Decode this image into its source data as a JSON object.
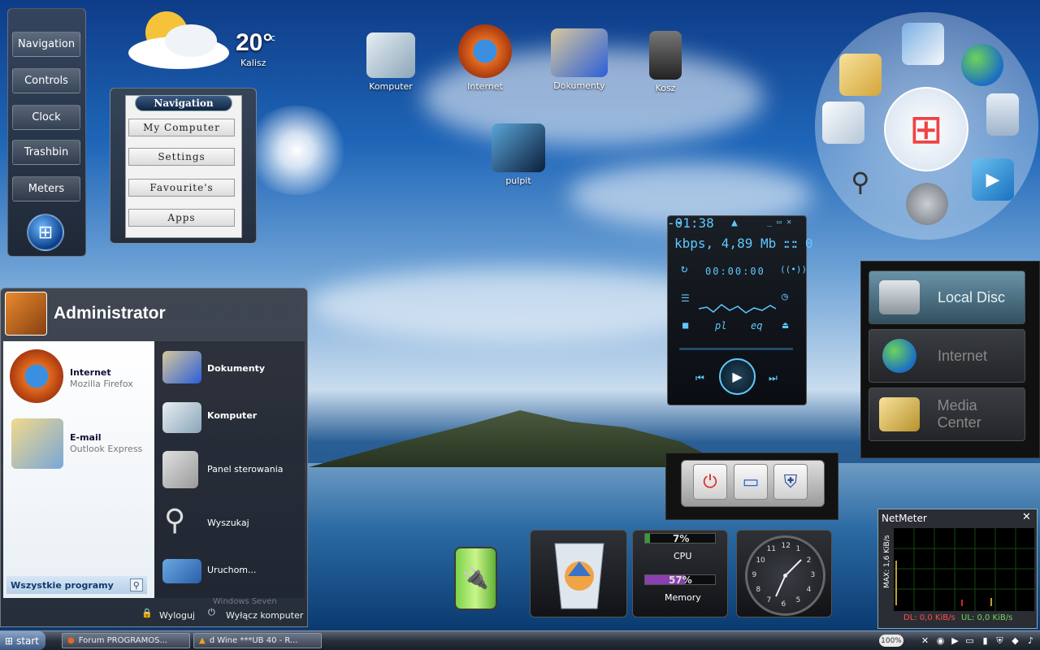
{
  "sidebar": {
    "items": [
      {
        "label": "Navigation"
      },
      {
        "label": "Controls"
      },
      {
        "label": "Clock"
      },
      {
        "label": "Trashbin"
      },
      {
        "label": "Meters"
      }
    ]
  },
  "weather": {
    "temp": "20°",
    "unit": "c",
    "city": "Kalisz"
  },
  "nav_panel": {
    "title": "Navigation",
    "buttons": [
      "My Computer",
      "Settings",
      "Favourite's",
      "Apps"
    ]
  },
  "desktop_icons": [
    {
      "label": "Komputer"
    },
    {
      "label": "Internet"
    },
    {
      "label": "Dokumenty"
    },
    {
      "label": "Kosz"
    },
    {
      "label": "pulpit"
    }
  ],
  "player": {
    "info": "kbps, 4,89 Mb ::",
    "info_right": ":: 0",
    "time": "-01:38",
    "elapsed": "00:00:00",
    "pl": "pl",
    "eq": "eq"
  },
  "quick_launch": [
    {
      "label": "Local Disc"
    },
    {
      "label": "Internet"
    },
    {
      "label": "Media Center"
    }
  ],
  "meters": {
    "cpu_value": "7%",
    "cpu_label": "CPU",
    "cpu_percent": 7,
    "memory_value": "57%",
    "memory_label": "Memory",
    "memory_percent": 57
  },
  "clock": {
    "numbers": [
      "12",
      "1",
      "2",
      "3",
      "4",
      "5",
      "6",
      "7",
      "8",
      "9",
      "10",
      "11"
    ]
  },
  "netmeter": {
    "title": "NetMeter",
    "close": "✕",
    "max": "MAX: 1,6 KiB/s",
    "dl": "DL: 0,0 KiB/s",
    "ul": "UL: 0,0 KiB/s"
  },
  "start_menu": {
    "user": "Administrator",
    "pinned": [
      {
        "title": "Internet",
        "subtitle": "Mozilla Firefox"
      },
      {
        "title": "E-mail",
        "subtitle": "Outlook Express"
      }
    ],
    "right_items": [
      {
        "label": "Dokumenty"
      },
      {
        "label": "Komputer"
      },
      {
        "label": "Panel sterowania"
      },
      {
        "label": "Wyszukaj"
      },
      {
        "label": "Uruchom..."
      }
    ],
    "all_programs": "Wszystkie programy",
    "logoff": "Wyloguj",
    "shutdown": "Wyłącz komputer",
    "watermark": "Windows Seven"
  },
  "taskbar": {
    "start": "start",
    "tasks": [
      {
        "label": "Forum PROGRAMOS..."
      },
      {
        "label": "d Wine ***UB 40 - R..."
      }
    ],
    "zoom": "100%"
  }
}
